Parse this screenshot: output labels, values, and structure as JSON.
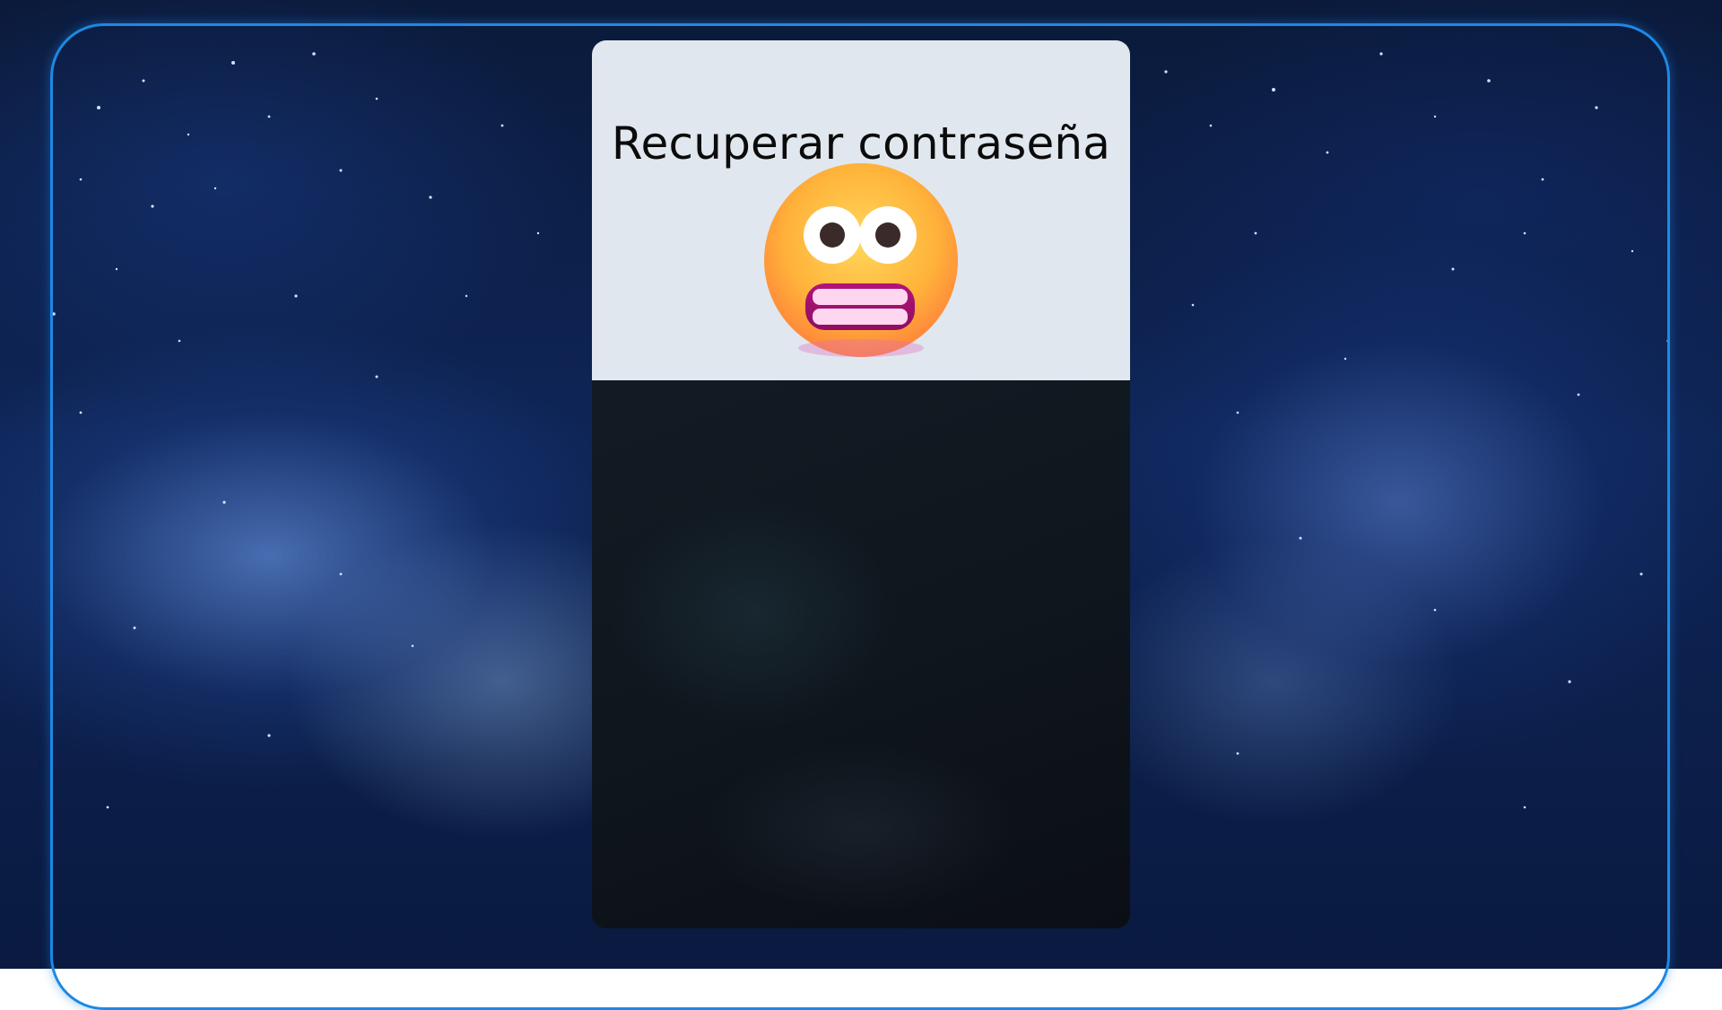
{
  "page": {
    "title": "Recuperar contraseña"
  },
  "emoji": {
    "icon": "grimacing-face-icon"
  },
  "colors": {
    "frame_border": "#1e88e5",
    "card_header_bg": "#e1e7ee",
    "card_body_bg": "#0f161d",
    "title_text": "#0b0b0b"
  }
}
